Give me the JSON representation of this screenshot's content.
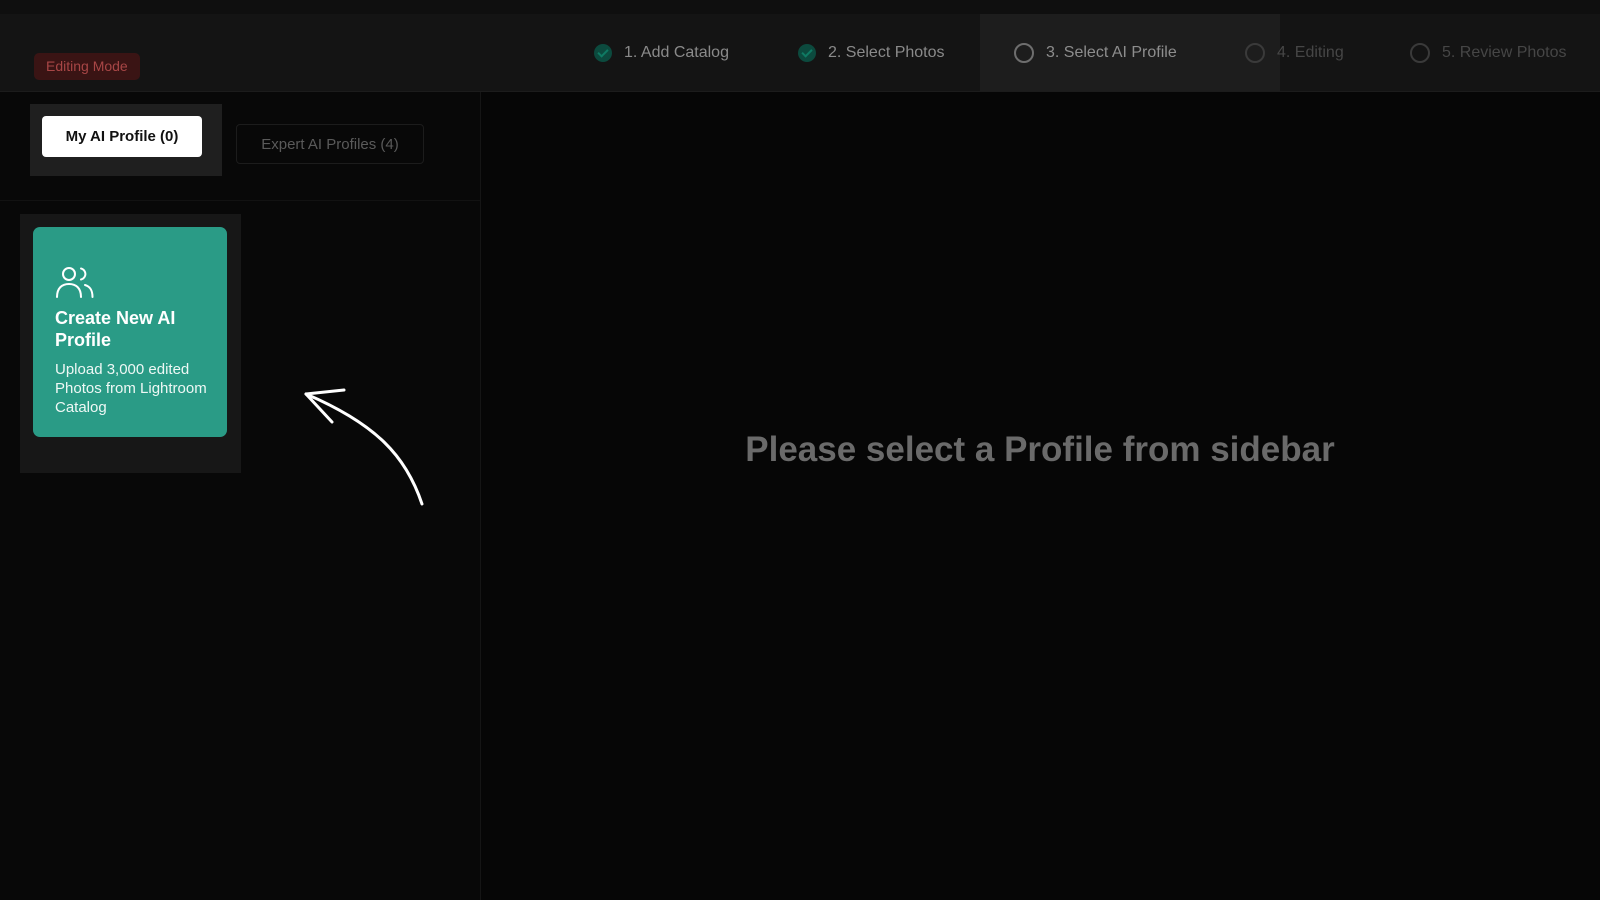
{
  "header": {
    "mode_badge": "Editing Mode",
    "steps": [
      {
        "label": "1. Add Catalog",
        "status": "done"
      },
      {
        "label": "2. Select Photos",
        "status": "done"
      },
      {
        "label": "3. Select AI Profile",
        "status": "current"
      },
      {
        "label": "4. Editing",
        "status": "todo"
      },
      {
        "label": "5. Review Photos",
        "status": "todo"
      }
    ]
  },
  "sidebar": {
    "tabs": [
      {
        "label": "My AI Profile (0)",
        "active": true
      },
      {
        "label": "Expert AI Profiles (4)",
        "active": false
      }
    ],
    "create_card": {
      "icon": "users-icon",
      "title": "Create New AI Profile",
      "description": "Upload 3,000 edited Photos from Lightroom Catalog",
      "color": "#2a9b86"
    }
  },
  "main": {
    "empty_message": "Please select a Profile from sidebar"
  },
  "colors": {
    "accent": "#2a9b86",
    "badge_bg": "#3a1414",
    "badge_text": "#a84646"
  }
}
